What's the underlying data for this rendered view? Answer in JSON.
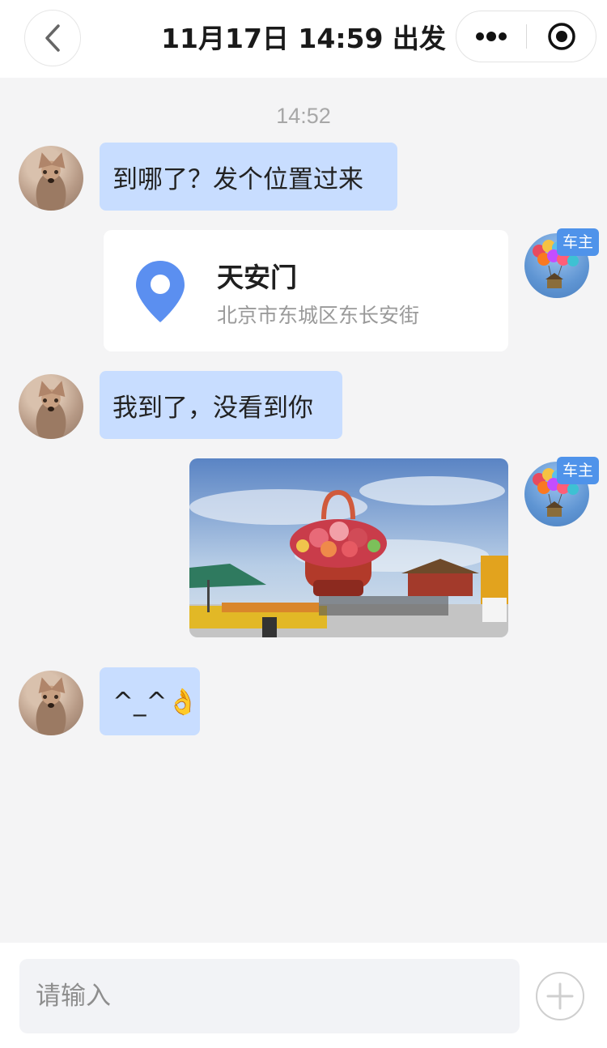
{
  "header": {
    "title": "11月17日 14:59 出发"
  },
  "chat": {
    "time": "14:52",
    "messages": [
      {
        "sender": "passenger",
        "type": "text",
        "text": "到哪了？发个位置过来"
      },
      {
        "sender": "owner",
        "type": "location",
        "badge": "车主",
        "name": "天安门",
        "address": "北京市东城区东长安街"
      },
      {
        "sender": "passenger",
        "type": "text",
        "text": "我到了，没看到你"
      },
      {
        "sender": "owner",
        "type": "image",
        "badge": "车主"
      },
      {
        "sender": "passenger",
        "type": "text",
        "text": "^_^👌"
      }
    ]
  },
  "input": {
    "placeholder": "请输入"
  },
  "colors": {
    "bubble": "#c8ddff",
    "accent": "#4f93ea",
    "location_pin": "#5b8ff0"
  }
}
